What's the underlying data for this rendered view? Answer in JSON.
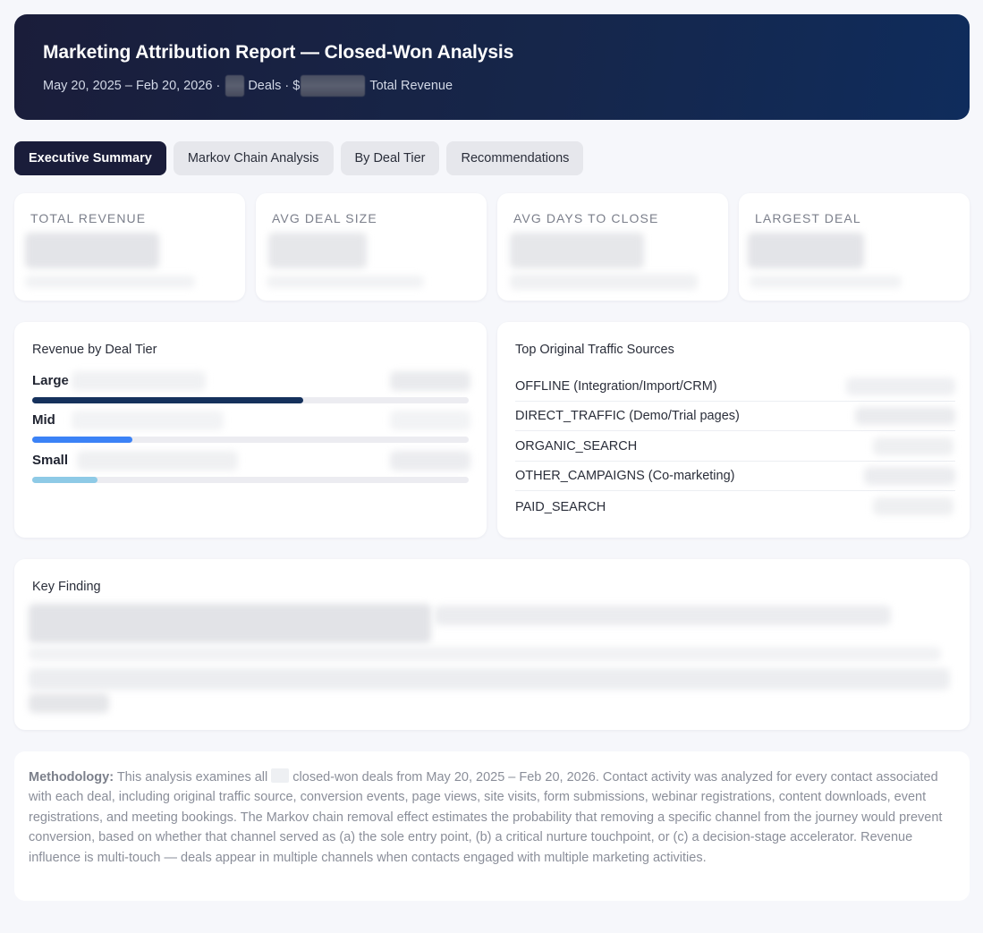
{
  "header": {
    "title": "Marketing Attribution Report — Closed-Won Analysis",
    "date_range": "May 20, 2025 – Feb 20, 2026 ·",
    "deals_label": "Deals · $",
    "revenue_label": "Total Revenue"
  },
  "tabs": [
    {
      "label": "Executive Summary",
      "active": true
    },
    {
      "label": "Markov Chain Analysis",
      "active": false
    },
    {
      "label": "By Deal Tier",
      "active": false
    },
    {
      "label": "Recommendations",
      "active": false
    }
  ],
  "kpis": [
    {
      "label": "TOTAL REVENUE"
    },
    {
      "label": "AVG DEAL SIZE"
    },
    {
      "label": "AVG DAYS TO CLOSE"
    },
    {
      "label": "LARGEST DEAL"
    }
  ],
  "revenue_by_tier": {
    "title": "Revenue by Deal Tier",
    "tiers": [
      {
        "name": "Large",
        "share": 0.62,
        "color": "#15315c"
      },
      {
        "name": "Mid",
        "share": 0.23,
        "color": "#3b82f6"
      },
      {
        "name": "Small",
        "share": 0.15,
        "color": "#8ecae6"
      }
    ]
  },
  "traffic_sources": {
    "title": "Top Original Traffic Sources",
    "items": [
      "OFFLINE (Integration/Import/CRM)",
      "DIRECT_TRAFFIC (Demo/Trial pages)",
      "ORGANIC_SEARCH",
      "OTHER_CAMPAIGNS (Co-marketing)",
      "PAID_SEARCH"
    ]
  },
  "key_finding": {
    "title": "Key Finding"
  },
  "methodology": {
    "label": "Methodology:",
    "text_a": " This analysis examines all ",
    "text_b": " closed-won deals from May 20, 2025 – Feb 20, 2026. Contact activity was analyzed for every contact associated with each deal, including original traffic source, conversion events, page views, site visits, form submissions, webinar registrations, content downloads, event registrations, and meeting bookings. The Markov chain removal effect estimates the probability that removing a specific channel from the journey would prevent conversion, based on whether that channel served as (a) the sole entry point, (b) a critical nurture touchpoint, or (c) a decision-stage accelerator. Revenue influence is multi-touch — deals appear in multiple channels when contacts engaged with multiple marketing activities."
  }
}
